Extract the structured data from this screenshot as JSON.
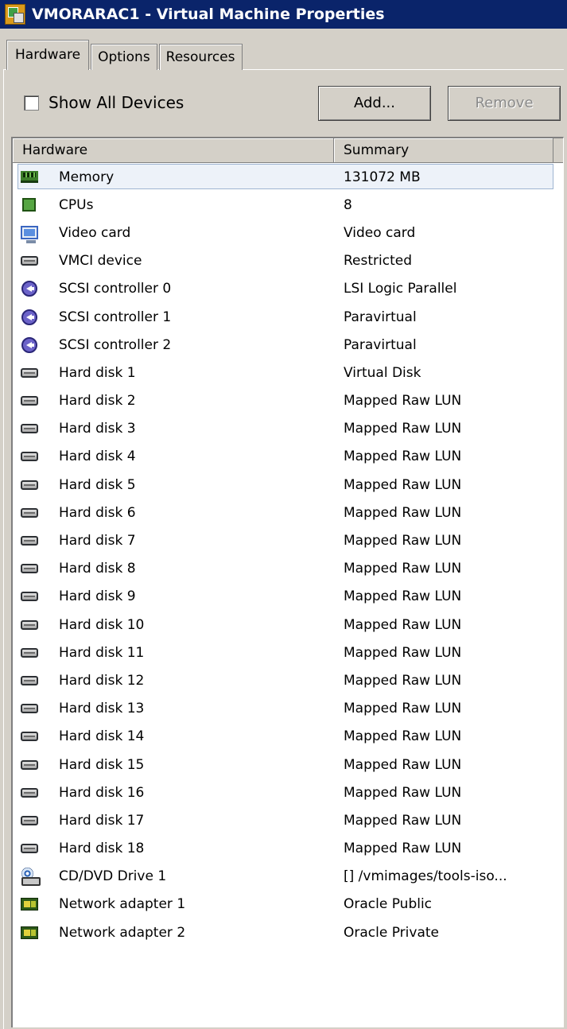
{
  "window": {
    "title": "VMORARAC1 - Virtual Machine Properties"
  },
  "tabs": [
    {
      "label": "Hardware",
      "active": true
    },
    {
      "label": "Options",
      "active": false
    },
    {
      "label": "Resources",
      "active": false
    }
  ],
  "toolbar": {
    "show_all_label": "Show All Devices",
    "show_all_checked": false,
    "add_label": "Add...",
    "remove_label": "Remove",
    "remove_enabled": false
  },
  "table": {
    "columns": [
      "Hardware",
      "Summary"
    ],
    "rows": [
      {
        "hardware": "Memory",
        "summary": "131072 MB",
        "icon": "memory-icon",
        "selected": true
      },
      {
        "hardware": "CPUs",
        "summary": "8",
        "icon": "cpu-icon"
      },
      {
        "hardware": "Video card",
        "summary": "Video card",
        "icon": "video-card-icon"
      },
      {
        "hardware": "VMCI device",
        "summary": "Restricted",
        "icon": "disk-icon"
      },
      {
        "hardware": "SCSI controller 0",
        "summary": "LSI Logic Parallel",
        "icon": "scsi-controller-icon"
      },
      {
        "hardware": "SCSI controller 1",
        "summary": "Paravirtual",
        "icon": "scsi-controller-icon"
      },
      {
        "hardware": "SCSI controller 2",
        "summary": "Paravirtual",
        "icon": "scsi-controller-icon"
      },
      {
        "hardware": "Hard disk 1",
        "summary": "Virtual Disk",
        "icon": "disk-icon"
      },
      {
        "hardware": "Hard disk 2",
        "summary": "Mapped Raw LUN",
        "icon": "disk-icon"
      },
      {
        "hardware": "Hard disk 3",
        "summary": "Mapped Raw LUN",
        "icon": "disk-icon"
      },
      {
        "hardware": "Hard disk 4",
        "summary": "Mapped Raw LUN",
        "icon": "disk-icon"
      },
      {
        "hardware": "Hard disk 5",
        "summary": "Mapped Raw LUN",
        "icon": "disk-icon"
      },
      {
        "hardware": "Hard disk 6",
        "summary": "Mapped Raw LUN",
        "icon": "disk-icon"
      },
      {
        "hardware": "Hard disk 7",
        "summary": "Mapped Raw LUN",
        "icon": "disk-icon"
      },
      {
        "hardware": "Hard disk 8",
        "summary": "Mapped Raw LUN",
        "icon": "disk-icon"
      },
      {
        "hardware": "Hard disk 9",
        "summary": "Mapped Raw LUN",
        "icon": "disk-icon"
      },
      {
        "hardware": "Hard disk 10",
        "summary": "Mapped Raw LUN",
        "icon": "disk-icon"
      },
      {
        "hardware": "Hard disk 11",
        "summary": "Mapped Raw LUN",
        "icon": "disk-icon"
      },
      {
        "hardware": "Hard disk 12",
        "summary": "Mapped Raw LUN",
        "icon": "disk-icon"
      },
      {
        "hardware": "Hard disk 13",
        "summary": "Mapped Raw LUN",
        "icon": "disk-icon"
      },
      {
        "hardware": "Hard disk 14",
        "summary": "Mapped Raw LUN",
        "icon": "disk-icon"
      },
      {
        "hardware": "Hard disk 15",
        "summary": "Mapped Raw LUN",
        "icon": "disk-icon"
      },
      {
        "hardware": "Hard disk 16",
        "summary": "Mapped Raw LUN",
        "icon": "disk-icon"
      },
      {
        "hardware": "Hard disk 17",
        "summary": "Mapped Raw LUN",
        "icon": "disk-icon"
      },
      {
        "hardware": "Hard disk 18",
        "summary": "Mapped Raw LUN",
        "icon": "disk-icon"
      },
      {
        "hardware": "CD/DVD Drive 1",
        "summary": "[] /vmimages/tools-iso...",
        "icon": "cd-dvd-icon"
      },
      {
        "hardware": "Network adapter 1",
        "summary": "Oracle Public",
        "icon": "network-adapter-icon"
      },
      {
        "hardware": "Network adapter 2",
        "summary": "Oracle Private",
        "icon": "network-adapter-icon"
      }
    ]
  }
}
